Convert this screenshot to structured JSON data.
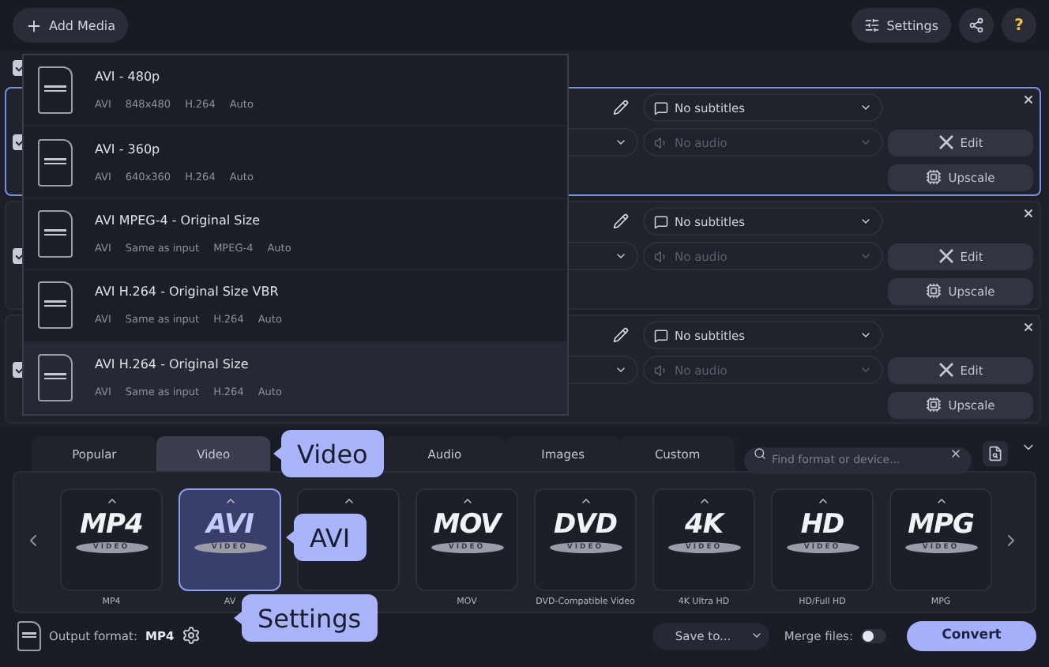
{
  "toolbar": {
    "add_media": "Add Media",
    "settings": "Settings",
    "help": "?"
  },
  "header_checkbox": {
    "checked": true
  },
  "files": [
    {
      "checked": true,
      "selected": true,
      "subtitles": "No subtitles",
      "audio": "No audio",
      "edit": "Edit",
      "upscale": "Upscale"
    },
    {
      "checked": true,
      "selected": false,
      "subtitles": "No subtitles",
      "audio": "No audio",
      "edit": "Edit",
      "upscale": "Upscale"
    },
    {
      "checked": true,
      "selected": false,
      "subtitles": "No subtitles",
      "audio": "No audio",
      "edit": "Edit",
      "upscale": "Upscale"
    }
  ],
  "preset_menu": {
    "items": [
      {
        "title": "AVI - 480p",
        "specs": [
          "AVI",
          "848x480",
          "H.264",
          "Auto"
        ],
        "selected": false
      },
      {
        "title": "AVI - 360p",
        "specs": [
          "AVI",
          "640x360",
          "H.264",
          "Auto"
        ],
        "selected": false
      },
      {
        "title": "AVI MPEG-4 - Original Size",
        "specs": [
          "AVI",
          "Same as input",
          "MPEG-4",
          "Auto"
        ],
        "selected": false
      },
      {
        "title": "AVI H.264 - Original Size VBR",
        "specs": [
          "AVI",
          "Same as input",
          "H.264",
          "Auto"
        ],
        "selected": false
      },
      {
        "title": "AVI H.264 - Original Size",
        "specs": [
          "AVI",
          "Same as input",
          "H.264",
          "Auto"
        ],
        "selected": true
      }
    ]
  },
  "format_tabs": [
    {
      "label": "Popular",
      "selected": false
    },
    {
      "label": "Video",
      "selected": true
    },
    {
      "label": "Audio",
      "selected": false
    },
    {
      "label": "Images",
      "selected": false
    },
    {
      "label": "Custom",
      "selected": false
    }
  ],
  "search": {
    "placeholder": "Find format or device..."
  },
  "formats": [
    {
      "logo": "MP4",
      "badge": "VIDEO",
      "label": "MP4",
      "selected": false
    },
    {
      "logo": "AVI",
      "badge": "VIDEO",
      "label": "AV",
      "selected": true
    },
    {
      "selected": false
    },
    {
      "logo": "MOV",
      "badge": "VIDEO",
      "label": "MOV",
      "selected": false
    },
    {
      "logo": "DVD",
      "badge": "VIDEO",
      "label": "DVD-Compatible Video",
      "selected": false
    },
    {
      "logo": "4K",
      "badge": "VIDEO",
      "label": "4K Ultra HD",
      "selected": false
    },
    {
      "logo": "HD",
      "badge": "VIDEO",
      "label": "HD/Full HD",
      "selected": false
    },
    {
      "logo": "MPG",
      "badge": "VIDEO",
      "label": "MPG",
      "selected": false
    }
  ],
  "output": {
    "label": "Output format:",
    "value": "MP4"
  },
  "save_to": "Save to...",
  "merge": {
    "label": "Merge files:",
    "on": false
  },
  "convert": "Convert",
  "callouts": [
    {
      "text": "Video"
    },
    {
      "text": "AVI"
    },
    {
      "text": "Settings"
    }
  ]
}
